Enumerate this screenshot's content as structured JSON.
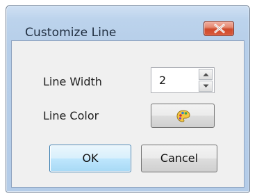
{
  "dialog": {
    "title": "Customize Line",
    "close_icon": "close-x-icon"
  },
  "fields": {
    "line_width_label": "Line Width",
    "line_width_value": "2",
    "line_color_label": "Line Color",
    "color_button_icon": "palette-icon"
  },
  "buttons": {
    "ok_label": "OK",
    "cancel_label": "Cancel"
  },
  "colors": {
    "title_bar": "#bcd3ec",
    "close_button": "#cf4a2c",
    "default_button_border": "#3c7fb1"
  }
}
